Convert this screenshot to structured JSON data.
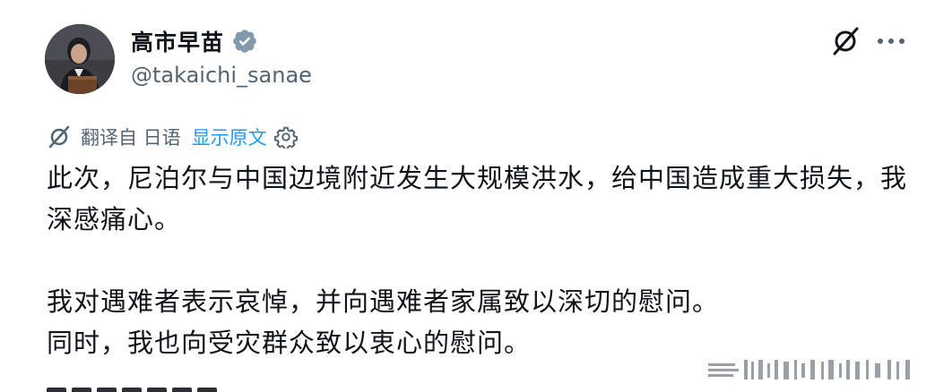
{
  "author": {
    "display_name": "高市早苗",
    "handle": "@takaichi_sanae"
  },
  "translation": {
    "label": "翻译自 日语",
    "show_original": "显示原文"
  },
  "post": {
    "paragraph_1": "此次，尼泊尔与中国边境附近发生大规模洪水，给中国造成重大损失，我深感痛心。",
    "paragraph_2": "我对遇难者表示哀悼，并向遇难者家属致以深切的慰问。",
    "paragraph_3": "同时，我也向受灾群众致以衷心的慰问。"
  },
  "icons": {
    "verified": "verified-badge-icon",
    "grok": "grok-icon",
    "more": "more-options-icon",
    "translate": "translate-icon",
    "settings": "settings-gear-icon"
  },
  "colors": {
    "text": "#0f1419",
    "secondary": "#536471",
    "link": "#1d9bf0"
  }
}
